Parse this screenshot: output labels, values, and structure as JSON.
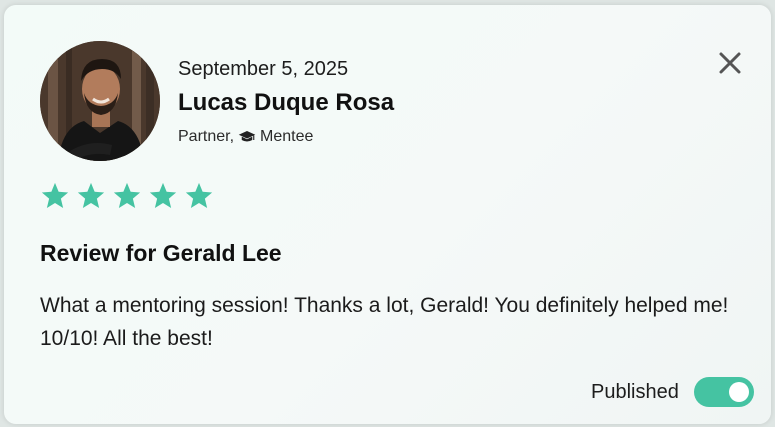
{
  "review": {
    "date": "September 5, 2025",
    "author_name": "Lucas Duque Rosa",
    "role_primary": "Partner,",
    "role_secondary": "Mentee",
    "rating": 5,
    "rating_max": 5,
    "title": "Review for Gerald Lee",
    "body": "What a mentoring session! Thanks a lot, Gerald! You definitely helped me! 10/10! All the best!",
    "status_label": "Published",
    "published": true
  },
  "icons": {
    "close": "close-icon",
    "role": "graduation-cap-icon",
    "star": "star-icon"
  },
  "colors": {
    "accent": "#45c3a2",
    "star": "#45c3a2",
    "close": "#555555"
  }
}
